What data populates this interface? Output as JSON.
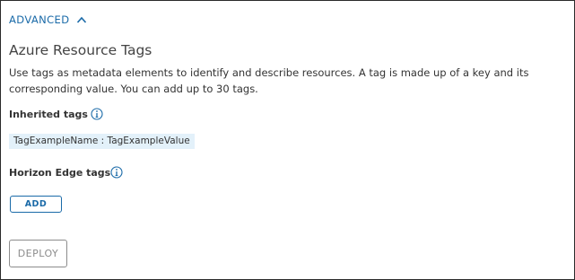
{
  "advanced": {
    "label": "ADVANCED",
    "expanded": true,
    "icon": "chevron-up-icon"
  },
  "section": {
    "title": "Azure Resource Tags",
    "description": "Use tags as metadata elements to identify and describe resources. A tag is made up of a key and its corresponding value. You can add up to 30 tags."
  },
  "inherited_tags": {
    "label": "Inherited tags",
    "icon": "info-icon",
    "tags": [
      "TagExampleName : TagExampleValue"
    ]
  },
  "edge_tags": {
    "label": "Horizon Edge tags",
    "icon": "info-icon"
  },
  "buttons": {
    "add_label": "ADD",
    "deploy_label": "DEPLOY"
  },
  "colors": {
    "accent": "#1a6aa8",
    "chip_bg": "#e3f1fa",
    "disabled": "#8c8c8c",
    "border": "#2b2b2b"
  }
}
